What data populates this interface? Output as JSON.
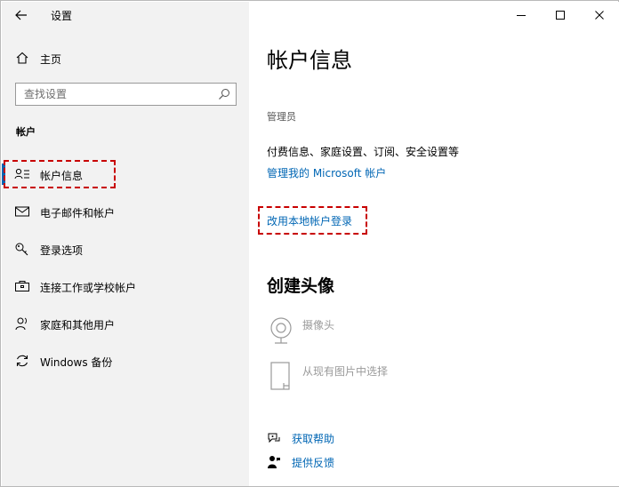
{
  "window": {
    "title": "设置",
    "controls": {
      "minimize": "minimize-icon",
      "maximize": "maximize-icon",
      "close": "close-icon"
    }
  },
  "sidebar": {
    "home_label": "主页",
    "search_placeholder": "查找设置",
    "section_title": "帐户",
    "items": [
      {
        "label": "帐户信息",
        "icon": "person-list-icon",
        "selected": true
      },
      {
        "label": "电子邮件和帐户",
        "icon": "mail-icon"
      },
      {
        "label": "登录选项",
        "icon": "key-icon"
      },
      {
        "label": "连接工作或学校帐户",
        "icon": "briefcase-icon"
      },
      {
        "label": "家庭和其他用户",
        "icon": "person-add-icon"
      },
      {
        "label": "Windows 备份",
        "icon": "sync-icon"
      }
    ]
  },
  "main": {
    "title": "帐户信息",
    "role": "管理员",
    "description": "付费信息、家庭设置、订阅、安全设置等",
    "manage_link": "管理我的 Microsoft 帐户",
    "local_link": "改用本地帐户登录",
    "create_avatar_title": "创建头像",
    "avatar_options": [
      {
        "label": "摄像头",
        "icon": "camera-icon"
      },
      {
        "label": "从现有图片中选择",
        "icon": "browse-file-icon"
      }
    ],
    "help_links": [
      {
        "label": "获取帮助",
        "icon": "help-chat-icon"
      },
      {
        "label": "提供反馈",
        "icon": "feedback-icon"
      }
    ]
  },
  "colors": {
    "accent": "#0066b4",
    "sidebar_bg": "#f2f2f2",
    "annotation": "#c80000"
  }
}
